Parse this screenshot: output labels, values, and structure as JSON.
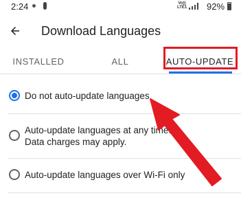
{
  "status_bar": {
    "time": "2:24",
    "network_label": "Vo)) LTE1",
    "battery": "92%"
  },
  "app_bar": {
    "title": "Download Languages",
    "back_icon": "arrow-back-icon"
  },
  "tabs": [
    {
      "label": "INSTALLED",
      "selected": false
    },
    {
      "label": "ALL",
      "selected": false
    },
    {
      "label": "AUTO-UPDATE",
      "selected": true
    }
  ],
  "options": [
    {
      "label": "Do not auto-update languages",
      "selected": true
    },
    {
      "label": "Auto-update languages at any time.",
      "note": "Data charges may apply.",
      "selected": false
    },
    {
      "label": "Auto-update languages over Wi-Fi only",
      "selected": false
    }
  ],
  "colors": {
    "accent": "#1a73e8",
    "annotation": "#e31b23"
  }
}
